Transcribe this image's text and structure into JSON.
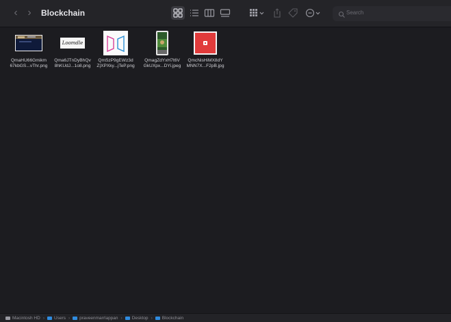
{
  "toolbar": {
    "back_icon": "chevron-left-icon",
    "forward_icon": "chevron-right-icon",
    "title": "Blockchain",
    "view_icons": [
      "icon-view-icon",
      "list-view-icon",
      "column-view-icon",
      "gallery-view-icon"
    ],
    "group_icon": "group-by-icon",
    "share_icon": "share-icon",
    "tag_icon": "tag-icon",
    "action_icon": "more-actions-icon",
    "search_placeholder": "Search"
  },
  "files": [
    {
      "name_line1": "QmaHU66Gmikm",
      "name_line2": "67kbGS...vThr.png",
      "thumb": "dark-website-screenshot"
    },
    {
      "name_line1": "Qma6JTnDyBhQv",
      "name_line2": "8hKUdJ...1o8.png",
      "thumb": "signature-logo",
      "thumb_text": "Loomdle"
    },
    {
      "name_line1": "QmSzP9gEWz3d",
      "name_line2": "Z|XPXky...jTeP.png",
      "thumb": "pink-blue-logo"
    },
    {
      "name_line1": "QmagZdYxH7t6V",
      "name_line2": "GkUXpx...DYi.jpeg",
      "thumb": "phone-screenshot"
    },
    {
      "name_line1": "QmcNisHiMX8dY",
      "name_line2": "MNN7X...F2pB.jpg",
      "thumb": "red-square-logo"
    }
  ],
  "pathbar": [
    {
      "label": "Macintosh HD",
      "icon": "disk-icon"
    },
    {
      "label": "Users",
      "icon": "folder-icon"
    },
    {
      "label": "praveenmarrlappan",
      "icon": "folder-icon"
    },
    {
      "label": "Desktop",
      "icon": "folder-icon"
    },
    {
      "label": "Blockchain",
      "icon": "folder-icon"
    }
  ],
  "colors": {
    "folder": "#2f8ce0",
    "accent_red": "#e13b3b",
    "background": "#1c1c20"
  }
}
